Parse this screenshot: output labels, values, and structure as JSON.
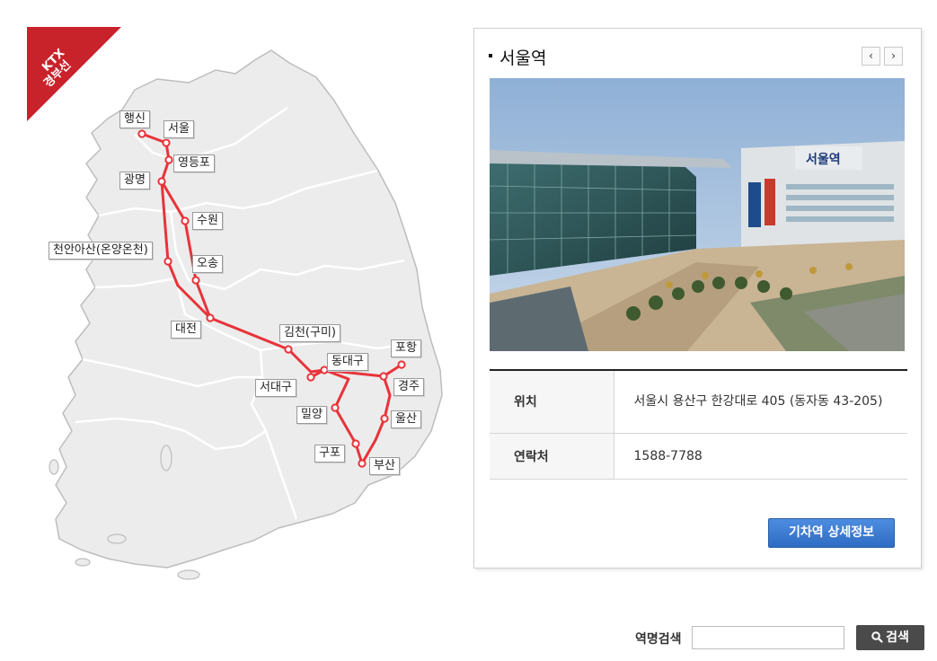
{
  "map": {
    "ribbon": {
      "line1": "KTX",
      "line2": "경부선",
      "color": "#c8222a"
    },
    "route_color": "#e8333a",
    "stations": [
      {
        "id": "haengsin",
        "name": "행신"
      },
      {
        "id": "seoul",
        "name": "서울"
      },
      {
        "id": "yeongdeungpo",
        "name": "영등포"
      },
      {
        "id": "gwangmyeong",
        "name": "광명"
      },
      {
        "id": "suwon",
        "name": "수원"
      },
      {
        "id": "cheonan",
        "name": "천안아산(온양온천)"
      },
      {
        "id": "osong",
        "name": "오송"
      },
      {
        "id": "daejeon",
        "name": "대전"
      },
      {
        "id": "gimcheon",
        "name": "김천(구미)"
      },
      {
        "id": "dongdaegu",
        "name": "동대구"
      },
      {
        "id": "seodaegu",
        "name": "서대구"
      },
      {
        "id": "pohang",
        "name": "포항"
      },
      {
        "id": "gyeongju",
        "name": "경주"
      },
      {
        "id": "miryang",
        "name": "밀양"
      },
      {
        "id": "ulsan",
        "name": "울산"
      },
      {
        "id": "gupo",
        "name": "구포"
      },
      {
        "id": "busan",
        "name": "부산"
      }
    ]
  },
  "panel": {
    "title": "서울역",
    "prev_icon": "chevron-left-icon",
    "next_icon": "chevron-right-icon",
    "prev_symbol": "‹",
    "next_symbol": "›",
    "photo_sign": "서울역",
    "rows": [
      {
        "label": "위치",
        "value": "서울시 용산구 한강대로 405 (동자동 43-205)"
      },
      {
        "label": "연락처",
        "value": "1588-7788"
      }
    ],
    "detail_button": "기차역 상세정보"
  },
  "search": {
    "label": "역명검색",
    "placeholder": "",
    "button": "검색",
    "button_icon": "search-icon"
  }
}
